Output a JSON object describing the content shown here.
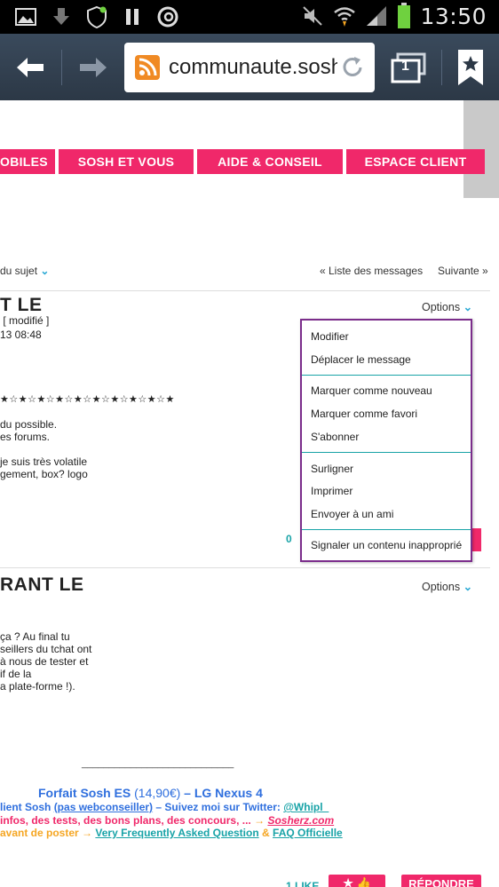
{
  "status_bar": {
    "time": "13:50"
  },
  "toolbar": {
    "url": "communaute.sosh",
    "tab_count": "1"
  },
  "nav": {
    "items": [
      "OBILES",
      "SOSH ET VOUS",
      "AIDE & CONSEIL",
      "ESPACE CLIENT"
    ]
  },
  "thread": {
    "subject_link": "du sujet",
    "list_link": "« Liste des messages",
    "next_link": "Suivante »"
  },
  "post1": {
    "title": "T LE",
    "modified": "[ modifié ]",
    "date": "13 08:48",
    "stars": "★☆★☆★☆★☆★☆★☆★☆★☆★☆★",
    "options_label": "Options",
    "lines": [
      "du possible.",
      "es forums.",
      "",
      " je suis très volatile",
      "gement, box? logo"
    ],
    "count_partial": "0"
  },
  "options_menu": {
    "groups": [
      [
        "Modifier",
        "Déplacer le message"
      ],
      [
        "Marquer comme nouveau",
        "Marquer comme favori",
        "S'abonner"
      ],
      [
        "Surligner",
        "Imprimer",
        "Envoyer à un ami"
      ],
      [
        "Signaler un contenu inapproprié"
      ]
    ]
  },
  "post2": {
    "title": "RANT LE",
    "options_label": "Options",
    "lines": [
      "ça ? Au final tu",
      "seillers du tchat ont",
      "à nous de tester et",
      "if de la",
      "a plate-forme !)."
    ]
  },
  "signature": {
    "rule": "____________________________",
    "line1_a": "Forfait Sosh ES",
    "line1_b": "(14,90€)",
    "line1_c": "– LG Nexus 4",
    "line2_a": "lient Sosh",
    "line2_b": "(pas webconseiller)",
    "line2_c": "– Suivez moi sur Twitter:",
    "line2_d": "@Whipl_",
    "line3_a": "infos, des tests, des bons plans, des concours, ...",
    "line3_b": "→",
    "line3_c": "Sosherz.com",
    "line4_a": "avant de poster",
    "line4_b": "→",
    "line4_c": "Very Frequently Asked Question",
    "line4_d": "&",
    "line4_e": "FAQ Officielle"
  },
  "footer_actions": {
    "like": "1 LIKE",
    "reply": "RÉPONDRE"
  },
  "colors": {
    "pink": "#f0286a",
    "teal": "#18a3a7",
    "purple": "#7b2d8b",
    "blue": "#2f6fde"
  }
}
